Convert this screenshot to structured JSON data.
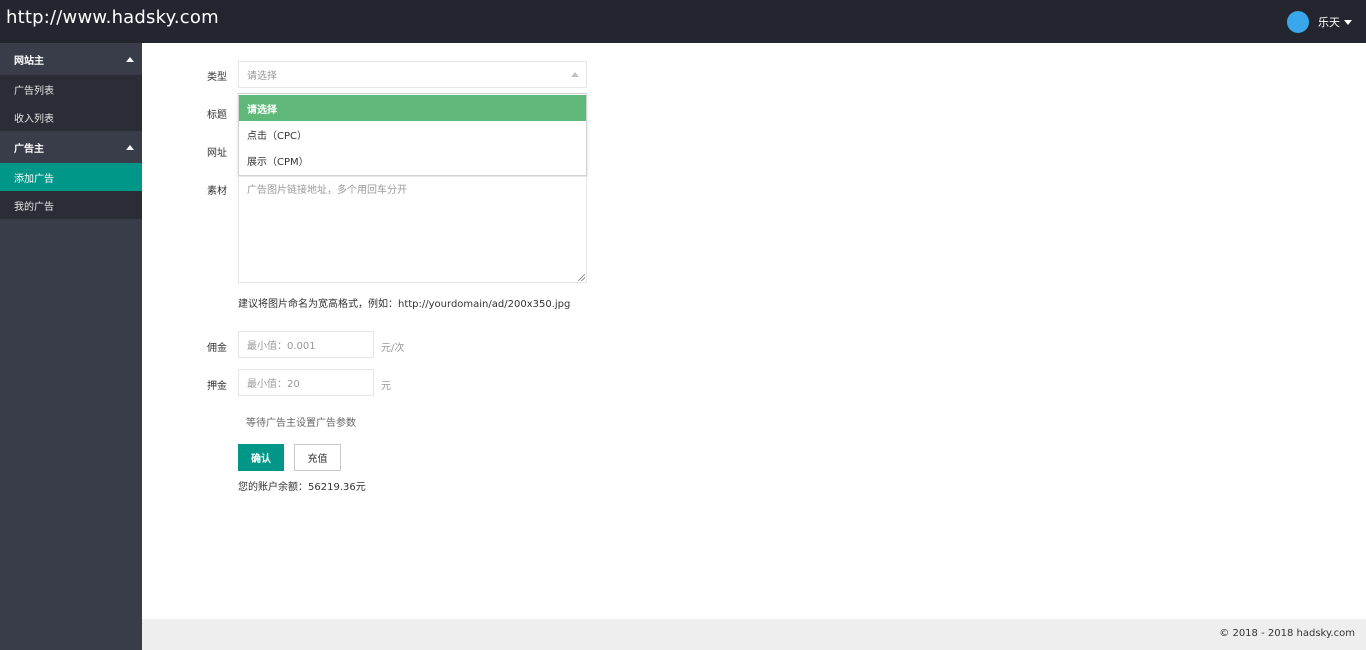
{
  "header": {
    "site_title": "http://www.hadsky.com",
    "user_name": "乐天"
  },
  "sidebar": {
    "groups": [
      {
        "label": "网站主",
        "items": [
          {
            "label": "广告列表"
          },
          {
            "label": "收入列表"
          }
        ]
      },
      {
        "label": "广告主",
        "items": [
          {
            "label": "添加广告"
          },
          {
            "label": "我的广告"
          }
        ]
      }
    ],
    "active_item": "添加广告"
  },
  "form": {
    "type_label": "类型",
    "type_placeholder": "请选择",
    "type_options": [
      "请选择",
      "点击（CPC）",
      "展示（CPM）"
    ],
    "title_label": "标题",
    "url_label": "网址",
    "material_label": "素材",
    "material_placeholder": "广告图片链接地址，多个用回车分开",
    "material_hint": "建议将图片命名为宽高格式，例如：http://yourdomain/ad/200x350.jpg",
    "commission_label": "佣金",
    "commission_placeholder": "最小值：0.001",
    "commission_unit": "元/次",
    "deposit_label": "押金",
    "deposit_placeholder": "最小值：20",
    "deposit_unit": "元",
    "status_text": "等待广告主设置广告参数",
    "confirm_button": "确认",
    "recharge_button": "充值",
    "balance_text": "您的账户余额：56219.36元"
  },
  "footer": {
    "copyright": "© 2018 - 2018 hadsky.com"
  },
  "colors": {
    "header_bg": "#23262e",
    "sidebar_bg": "#393d49",
    "accent": "#009688",
    "selected_option": "#5fb878"
  }
}
